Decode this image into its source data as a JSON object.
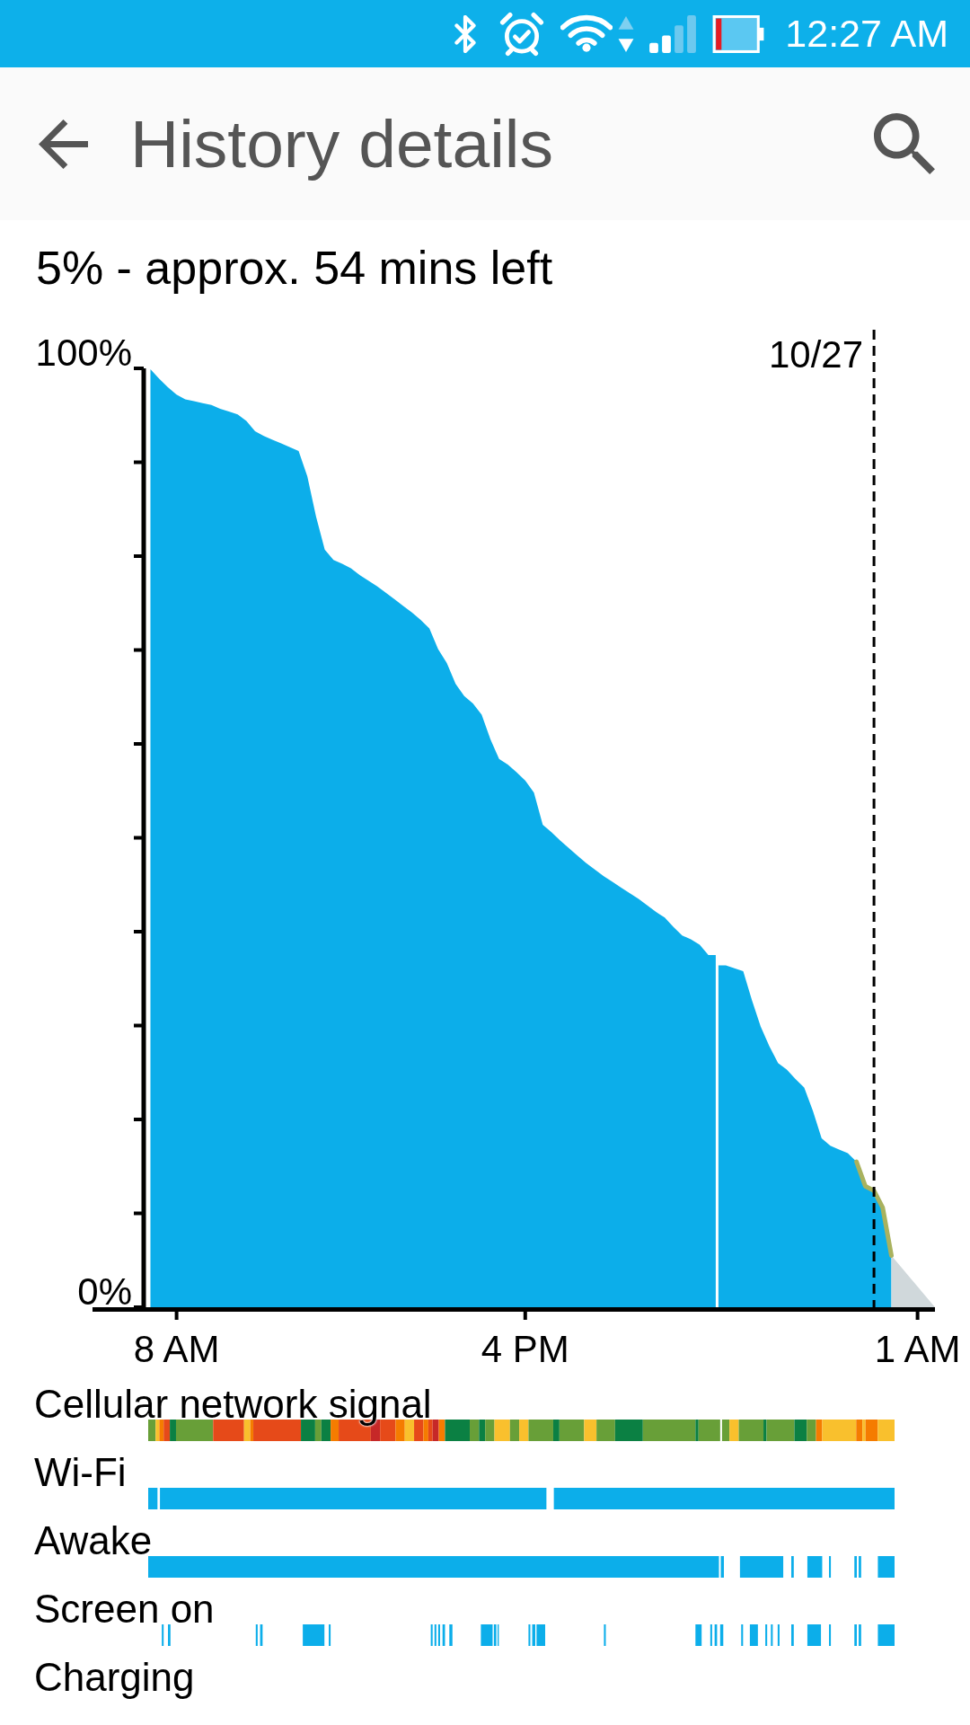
{
  "status_bar": {
    "time": "12:27 AM"
  },
  "header": {
    "title": "History details"
  },
  "summary": "5% - approx. 54 mins left",
  "chart": {
    "chart_data": {
      "type": "area",
      "categories": [
        null,
        null,
        null,
        "8 AM",
        null,
        null,
        null,
        null,
        null,
        null,
        null,
        null,
        null,
        null,
        null,
        null,
        null,
        null,
        null,
        null,
        null,
        null,
        null,
        null,
        null,
        null,
        null,
        null,
        null,
        null,
        null,
        null,
        null,
        null,
        null,
        null,
        null,
        null,
        null,
        null,
        null,
        null,
        null,
        "4 PM",
        null,
        null,
        null,
        null,
        null,
        null,
        null,
        null,
        null,
        null,
        null,
        null,
        null,
        null,
        null,
        null,
        null,
        null,
        null,
        null,
        null,
        null,
        null,
        null,
        null,
        null,
        null,
        null,
        null,
        null,
        null,
        null,
        null,
        null,
        null,
        null,
        null,
        null,
        null,
        null,
        null,
        null,
        null,
        null,
        "1 AM",
        null,
        null
      ],
      "series": [
        {
          "color": "#0caeea",
          "values": [
            99.9,
            98.9,
            98.0,
            97.2,
            96.7,
            96.5,
            96.3,
            96.1,
            95.7,
            95.4,
            95.1,
            94.4,
            93.3,
            92.8,
            92.4,
            92.0,
            91.6,
            91.2,
            88.5,
            84.2,
            80.7,
            79.6,
            79.2,
            78.7,
            78.0,
            77.4,
            76.8,
            76.1,
            75.4,
            74.7,
            74.0,
            73.2,
            72.3,
            70.1,
            68.6,
            66.4,
            65.1,
            64.3,
            63.1,
            60.5,
            58.4,
            57.8,
            57.0,
            56.1,
            54.8,
            51.4,
            50.6,
            49.7,
            48.9,
            48.1,
            47.3,
            46.6,
            45.9,
            45.3,
            44.7,
            44.1,
            43.5,
            42.8,
            42.1,
            41.5,
            40.5,
            39.6,
            39.2,
            38.6,
            37.5,
            null,
            36.4,
            36.1,
            35.8,
            32.7,
            29.9,
            27.8,
            26.0,
            25.3,
            24.3,
            23.4,
            20.9,
            18.0,
            17.2,
            16.8,
            16.4,
            15.5,
            12.9,
            12.4,
            10.6,
            5.5,
            null,
            null,
            null,
            null,
            null
          ]
        },
        {
          "color": "#d0d8db",
          "values": [
            null,
            null,
            null,
            null,
            null,
            null,
            null,
            null,
            null,
            null,
            null,
            null,
            null,
            null,
            null,
            null,
            null,
            null,
            null,
            null,
            null,
            null,
            null,
            null,
            null,
            null,
            null,
            null,
            null,
            null,
            null,
            null,
            null,
            null,
            null,
            null,
            null,
            null,
            null,
            null,
            null,
            null,
            null,
            null,
            null,
            null,
            null,
            null,
            null,
            null,
            null,
            null,
            null,
            null,
            null,
            null,
            null,
            null,
            null,
            null,
            null,
            null,
            null,
            null,
            null,
            null,
            null,
            null,
            null,
            null,
            null,
            null,
            null,
            null,
            null,
            null,
            null,
            null,
            null,
            null,
            null,
            null,
            null,
            null,
            null,
            5.5,
            4.4,
            3.3,
            2.2,
            1.1,
            0
          ]
        },
        {
          "type": "line",
          "color": "#a9b25e",
          "values": [
            null,
            null,
            null,
            null,
            null,
            null,
            null,
            null,
            null,
            null,
            null,
            null,
            null,
            null,
            null,
            null,
            null,
            null,
            null,
            null,
            null,
            null,
            null,
            null,
            null,
            null,
            null,
            null,
            null,
            null,
            null,
            null,
            null,
            null,
            null,
            null,
            null,
            null,
            null,
            null,
            null,
            null,
            null,
            null,
            null,
            null,
            null,
            null,
            null,
            null,
            null,
            null,
            null,
            null,
            null,
            null,
            null,
            null,
            null,
            null,
            null,
            null,
            null,
            null,
            null,
            null,
            null,
            null,
            null,
            null,
            null,
            null,
            null,
            null,
            null,
            null,
            null,
            null,
            null,
            null,
            null,
            15.5,
            12.9,
            12.4,
            10.6,
            5.5,
            null,
            null,
            null,
            null,
            null
          ]
        }
      ],
      "ylim": [
        0,
        100
      ],
      "yticks": [
        {
          "value": 0,
          "label": "0%"
        },
        {
          "value": 100,
          "label": "100%"
        }
      ],
      "annotations": [
        "10/27"
      ]
    }
  },
  "tracks": [
    {
      "label": "Cellular network signal",
      "kind": "signal"
    },
    {
      "label": "Wi-Fi",
      "kind": "wifi"
    },
    {
      "label": "Awake",
      "kind": "awake"
    },
    {
      "label": "Screen on",
      "kind": "screen"
    },
    {
      "label": "Charging",
      "kind": "charging"
    }
  ]
}
